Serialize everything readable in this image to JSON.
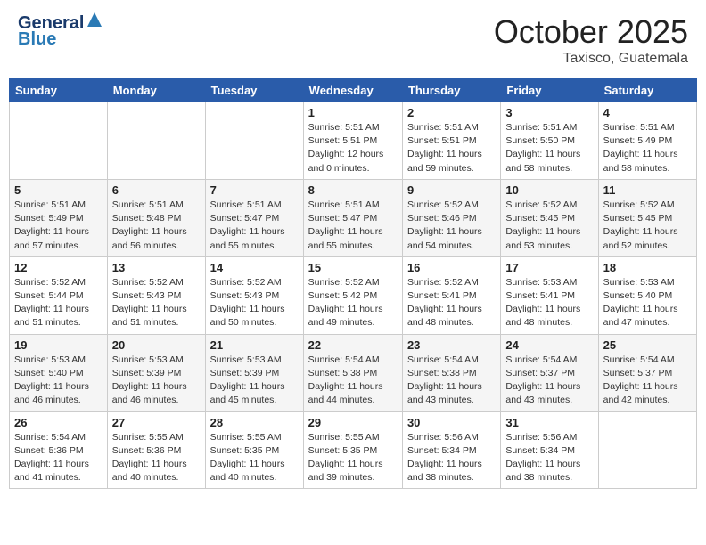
{
  "header": {
    "logo_line1": "General",
    "logo_line2": "Blue",
    "month": "October 2025",
    "location": "Taxisco, Guatemala"
  },
  "weekdays": [
    "Sunday",
    "Monday",
    "Tuesday",
    "Wednesday",
    "Thursday",
    "Friday",
    "Saturday"
  ],
  "weeks": [
    [
      {
        "day": "",
        "sunrise": "",
        "sunset": "",
        "daylight": ""
      },
      {
        "day": "",
        "sunrise": "",
        "sunset": "",
        "daylight": ""
      },
      {
        "day": "",
        "sunrise": "",
        "sunset": "",
        "daylight": ""
      },
      {
        "day": "1",
        "sunrise": "Sunrise: 5:51 AM",
        "sunset": "Sunset: 5:51 PM",
        "daylight": "Daylight: 12 hours and 0 minutes."
      },
      {
        "day": "2",
        "sunrise": "Sunrise: 5:51 AM",
        "sunset": "Sunset: 5:51 PM",
        "daylight": "Daylight: 11 hours and 59 minutes."
      },
      {
        "day": "3",
        "sunrise": "Sunrise: 5:51 AM",
        "sunset": "Sunset: 5:50 PM",
        "daylight": "Daylight: 11 hours and 58 minutes."
      },
      {
        "day": "4",
        "sunrise": "Sunrise: 5:51 AM",
        "sunset": "Sunset: 5:49 PM",
        "daylight": "Daylight: 11 hours and 58 minutes."
      }
    ],
    [
      {
        "day": "5",
        "sunrise": "Sunrise: 5:51 AM",
        "sunset": "Sunset: 5:49 PM",
        "daylight": "Daylight: 11 hours and 57 minutes."
      },
      {
        "day": "6",
        "sunrise": "Sunrise: 5:51 AM",
        "sunset": "Sunset: 5:48 PM",
        "daylight": "Daylight: 11 hours and 56 minutes."
      },
      {
        "day": "7",
        "sunrise": "Sunrise: 5:51 AM",
        "sunset": "Sunset: 5:47 PM",
        "daylight": "Daylight: 11 hours and 55 minutes."
      },
      {
        "day": "8",
        "sunrise": "Sunrise: 5:51 AM",
        "sunset": "Sunset: 5:47 PM",
        "daylight": "Daylight: 11 hours and 55 minutes."
      },
      {
        "day": "9",
        "sunrise": "Sunrise: 5:52 AM",
        "sunset": "Sunset: 5:46 PM",
        "daylight": "Daylight: 11 hours and 54 minutes."
      },
      {
        "day": "10",
        "sunrise": "Sunrise: 5:52 AM",
        "sunset": "Sunset: 5:45 PM",
        "daylight": "Daylight: 11 hours and 53 minutes."
      },
      {
        "day": "11",
        "sunrise": "Sunrise: 5:52 AM",
        "sunset": "Sunset: 5:45 PM",
        "daylight": "Daylight: 11 hours and 52 minutes."
      }
    ],
    [
      {
        "day": "12",
        "sunrise": "Sunrise: 5:52 AM",
        "sunset": "Sunset: 5:44 PM",
        "daylight": "Daylight: 11 hours and 51 minutes."
      },
      {
        "day": "13",
        "sunrise": "Sunrise: 5:52 AM",
        "sunset": "Sunset: 5:43 PM",
        "daylight": "Daylight: 11 hours and 51 minutes."
      },
      {
        "day": "14",
        "sunrise": "Sunrise: 5:52 AM",
        "sunset": "Sunset: 5:43 PM",
        "daylight": "Daylight: 11 hours and 50 minutes."
      },
      {
        "day": "15",
        "sunrise": "Sunrise: 5:52 AM",
        "sunset": "Sunset: 5:42 PM",
        "daylight": "Daylight: 11 hours and 49 minutes."
      },
      {
        "day": "16",
        "sunrise": "Sunrise: 5:52 AM",
        "sunset": "Sunset: 5:41 PM",
        "daylight": "Daylight: 11 hours and 48 minutes."
      },
      {
        "day": "17",
        "sunrise": "Sunrise: 5:53 AM",
        "sunset": "Sunset: 5:41 PM",
        "daylight": "Daylight: 11 hours and 48 minutes."
      },
      {
        "day": "18",
        "sunrise": "Sunrise: 5:53 AM",
        "sunset": "Sunset: 5:40 PM",
        "daylight": "Daylight: 11 hours and 47 minutes."
      }
    ],
    [
      {
        "day": "19",
        "sunrise": "Sunrise: 5:53 AM",
        "sunset": "Sunset: 5:40 PM",
        "daylight": "Daylight: 11 hours and 46 minutes."
      },
      {
        "day": "20",
        "sunrise": "Sunrise: 5:53 AM",
        "sunset": "Sunset: 5:39 PM",
        "daylight": "Daylight: 11 hours and 46 minutes."
      },
      {
        "day": "21",
        "sunrise": "Sunrise: 5:53 AM",
        "sunset": "Sunset: 5:39 PM",
        "daylight": "Daylight: 11 hours and 45 minutes."
      },
      {
        "day": "22",
        "sunrise": "Sunrise: 5:54 AM",
        "sunset": "Sunset: 5:38 PM",
        "daylight": "Daylight: 11 hours and 44 minutes."
      },
      {
        "day": "23",
        "sunrise": "Sunrise: 5:54 AM",
        "sunset": "Sunset: 5:38 PM",
        "daylight": "Daylight: 11 hours and 43 minutes."
      },
      {
        "day": "24",
        "sunrise": "Sunrise: 5:54 AM",
        "sunset": "Sunset: 5:37 PM",
        "daylight": "Daylight: 11 hours and 43 minutes."
      },
      {
        "day": "25",
        "sunrise": "Sunrise: 5:54 AM",
        "sunset": "Sunset: 5:37 PM",
        "daylight": "Daylight: 11 hours and 42 minutes."
      }
    ],
    [
      {
        "day": "26",
        "sunrise": "Sunrise: 5:54 AM",
        "sunset": "Sunset: 5:36 PM",
        "daylight": "Daylight: 11 hours and 41 minutes."
      },
      {
        "day": "27",
        "sunrise": "Sunrise: 5:55 AM",
        "sunset": "Sunset: 5:36 PM",
        "daylight": "Daylight: 11 hours and 40 minutes."
      },
      {
        "day": "28",
        "sunrise": "Sunrise: 5:55 AM",
        "sunset": "Sunset: 5:35 PM",
        "daylight": "Daylight: 11 hours and 40 minutes."
      },
      {
        "day": "29",
        "sunrise": "Sunrise: 5:55 AM",
        "sunset": "Sunset: 5:35 PM",
        "daylight": "Daylight: 11 hours and 39 minutes."
      },
      {
        "day": "30",
        "sunrise": "Sunrise: 5:56 AM",
        "sunset": "Sunset: 5:34 PM",
        "daylight": "Daylight: 11 hours and 38 minutes."
      },
      {
        "day": "31",
        "sunrise": "Sunrise: 5:56 AM",
        "sunset": "Sunset: 5:34 PM",
        "daylight": "Daylight: 11 hours and 38 minutes."
      },
      {
        "day": "",
        "sunrise": "",
        "sunset": "",
        "daylight": ""
      }
    ]
  ]
}
